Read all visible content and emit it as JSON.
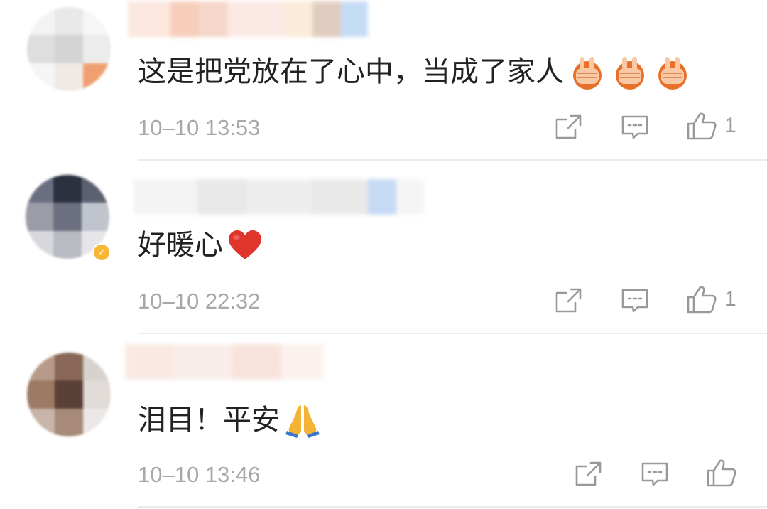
{
  "comments": [
    {
      "text": "这是把党放在了心中，当成了家人",
      "emoji": "victory-hand-emoji",
      "timestamp": "10–10 13:53",
      "like_count": "1"
    },
    {
      "text": "好暖心",
      "emoji": "red-heart-emoji",
      "timestamp": "10–10 22:32",
      "like_count": "1"
    },
    {
      "text": "泪目！平安",
      "emoji": "folded-hands-emoji",
      "timestamp": "10–10 13:46",
      "like_count": ""
    }
  ],
  "icons": {
    "share": "share-icon",
    "reply": "comment-icon",
    "like": "thumbs-up-icon"
  },
  "colors": {
    "text": "#222222",
    "meta": "#a8a8a8",
    "icon": "#999999",
    "divider": "#ececec",
    "verified_badge": "#f7b734"
  }
}
